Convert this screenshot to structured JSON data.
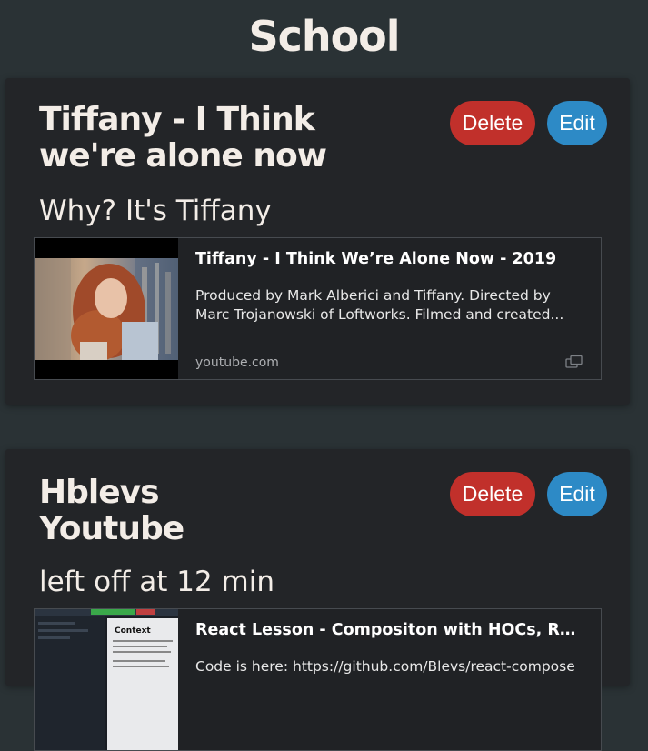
{
  "page": {
    "title": "School"
  },
  "cards": [
    {
      "title": "Tiffany - I Think we're alone now",
      "description": "Why? It's Tiffany",
      "delete_label": "Delete",
      "edit_label": "Edit",
      "embed": {
        "title": "Tiffany - I Think We’re Alone Now - 2019",
        "text": "Produced by Mark Alberici and Tiffany. Directed by Marc Trojanowski of Loftworks. Filmed and created...",
        "domain": "youtube.com",
        "icon": "external-link-icon"
      }
    },
    {
      "title": "Hblevs Youtube",
      "description": "left off at 12 min",
      "delete_label": "Delete",
      "edit_label": "Edit",
      "embed": {
        "title": "React Lesson - Compositon with HOCs, Ren...",
        "text": "Code is here: https://github.com/Blevs/react-compose",
        "thumbnail_heading": "Context"
      }
    }
  ],
  "colors": {
    "background": "#2a3235",
    "card": "#232528",
    "delete": "#c1302b",
    "edit": "#2d8ac6"
  }
}
